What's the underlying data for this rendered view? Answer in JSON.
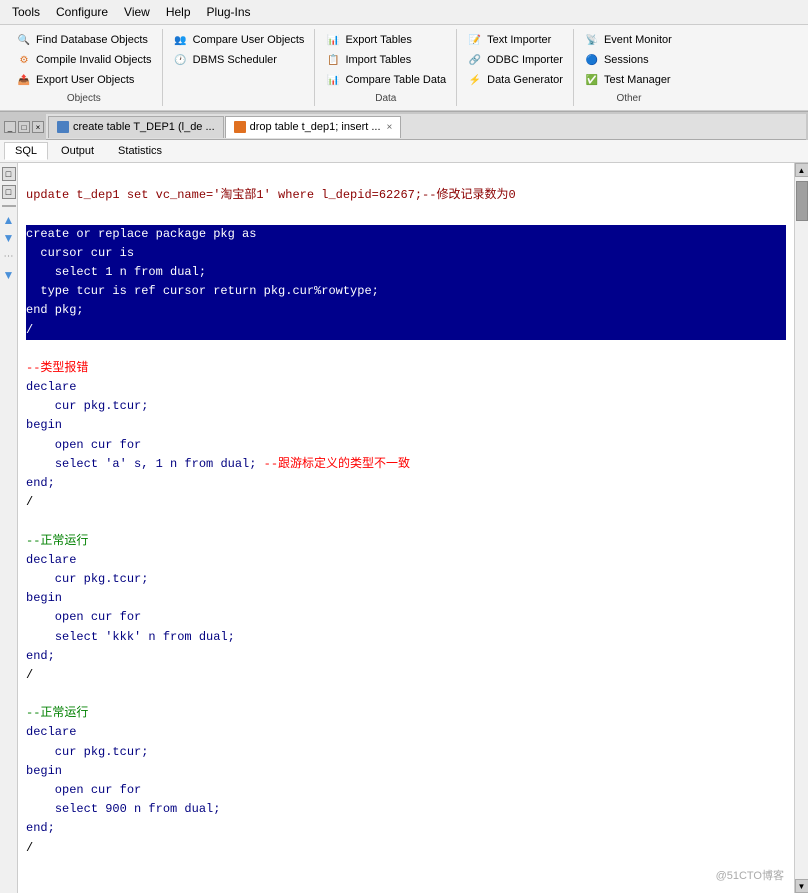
{
  "menubar": {
    "items": [
      "Tools",
      "Configure",
      "View",
      "Help",
      "Plug-Ins"
    ]
  },
  "toolbar": {
    "groups": [
      {
        "label": "Objects",
        "buttons": [
          {
            "id": "find-db-objects",
            "icon": "🔍",
            "label": "Find Database Objects"
          },
          {
            "id": "compile-invalid",
            "icon": "⚙",
            "label": "Compile Invalid Objects"
          },
          {
            "id": "export-user-objects",
            "icon": "📤",
            "label": "Export User Objects"
          }
        ]
      },
      {
        "label": "",
        "buttons": [
          {
            "id": "compare-user-objects",
            "icon": "👥",
            "label": "Compare User Objects"
          },
          {
            "id": "dbms-scheduler",
            "icon": "🕐",
            "label": "DBMS Scheduler"
          }
        ]
      },
      {
        "label": "Data",
        "buttons": [
          {
            "id": "export-tables",
            "icon": "📊",
            "label": "Export Tables"
          },
          {
            "id": "import-tables",
            "icon": "📋",
            "label": "Import Tables"
          },
          {
            "id": "compare-table-data",
            "icon": "📊",
            "label": "Compare Table Data"
          }
        ]
      },
      {
        "label": "",
        "buttons": [
          {
            "id": "text-importer",
            "icon": "📝",
            "label": "Text Importer"
          },
          {
            "id": "odbc-importer",
            "icon": "🔗",
            "label": "ODBC Importer"
          },
          {
            "id": "data-generator",
            "icon": "⚡",
            "label": "Data Generator"
          }
        ]
      },
      {
        "label": "Other",
        "buttons": [
          {
            "id": "event-monitor",
            "icon": "📡",
            "label": "Event Monitor"
          },
          {
            "id": "sessions",
            "icon": "🔵",
            "label": "Sessions"
          },
          {
            "id": "test-manager",
            "icon": "✅",
            "label": "Test Manager"
          }
        ]
      }
    ]
  },
  "tabs": [
    {
      "id": "tab1",
      "label": "create table T_DEP1 (l_de ...",
      "icon": "blue",
      "active": false
    },
    {
      "id": "tab2",
      "label": "drop table t_dep1; insert ...",
      "icon": "orange",
      "active": true
    }
  ],
  "subtabs": [
    {
      "id": "sql",
      "label": "SQL",
      "active": true
    },
    {
      "id": "output",
      "label": "Output",
      "active": false
    },
    {
      "id": "statistics",
      "label": "Statistics",
      "active": false
    }
  ],
  "code": {
    "line1": "update t_dep1 set vc_name='淘宝部1' where l_depid=62267;--修改记录数为0",
    "block_selected": [
      "create or replace package pkg as",
      "  cursor cur is",
      "    select 1 n from dual;",
      "  type tcur is ref cursor return pkg.cur%rowtype;",
      "end pkg;"
    ],
    "slash1": "/",
    "comment1": "--类型报错",
    "block2": [
      "declare",
      "  cur pkg.tcur;",
      "begin",
      "  open cur for",
      "    select 'a' s, 1 n from dual;",
      "end;"
    ],
    "comment2": "--跟游标定义的类型不一致",
    "slash2": "/",
    "comment3": "--正常运行",
    "block3": [
      "declare",
      "  cur pkg.tcur;",
      "begin",
      "  open cur for",
      "    select 'kkk' n from dual;",
      "end;"
    ],
    "slash3": "/",
    "comment4": "--正常运行",
    "block4": [
      "declare",
      "  cur pkg.tcur;",
      "begin",
      "  open cur for",
      "    select 900 n from dual;",
      "end;"
    ],
    "slash4": "/"
  },
  "watermark": "@51CTO博客"
}
